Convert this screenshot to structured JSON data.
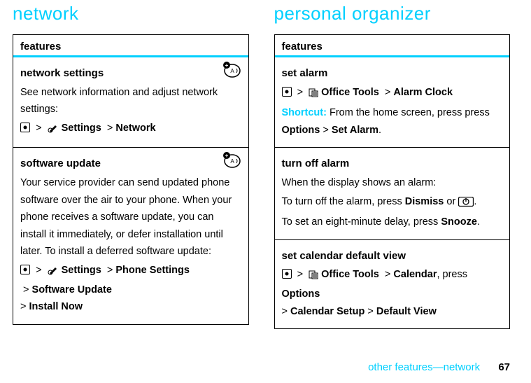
{
  "left": {
    "heading": "network",
    "features_label": "features",
    "items": [
      {
        "title": "network settings",
        "body": "See network information and adjust network settings:",
        "path_prefix": "",
        "settings": "Settings",
        "gt": ">",
        "tail": "Network"
      },
      {
        "title": "software update",
        "body": "Your service provider can send updated phone software over the air to your phone. When your phone receives a software update, you can install it immediately, or defer installation until later. To install a deferred software update:",
        "settings": "Settings",
        "gt": ">",
        "path2a": "Phone Settings",
        "path2b": "Software Update",
        "path2c": "Install Now"
      }
    ]
  },
  "right": {
    "heading": "personal organizer",
    "features_label": "features",
    "items": [
      {
        "title": "set alarm",
        "tools": "Office Tools",
        "gt": ">",
        "tail": "Alarm Clock",
        "shortcut_label": "Shortcut:",
        "shortcut_body_a": " From the home screen, press press ",
        "shortcut_b1": "Options",
        "shortcut_b2": "Set Alarm",
        "period": "."
      },
      {
        "title": "turn off alarm",
        "line1": "When the display shows an alarm:",
        "line2a": "To turn off the alarm, press ",
        "dismiss": "Dismiss",
        "line2b": " or ",
        "line2c": ".",
        "line3a": "To set an eight-minute delay, press ",
        "snooze": "Snooze",
        "line3b": "."
      },
      {
        "title": "set calendar default view",
        "tools": "Office Tools",
        "gt": ">",
        "cal": "Calendar",
        "press": ", press ",
        "opts": "Options",
        "cs": "Calendar Setup",
        "dv": "Default View"
      }
    ]
  },
  "footer": {
    "text": "other features—network",
    "page": "67"
  }
}
